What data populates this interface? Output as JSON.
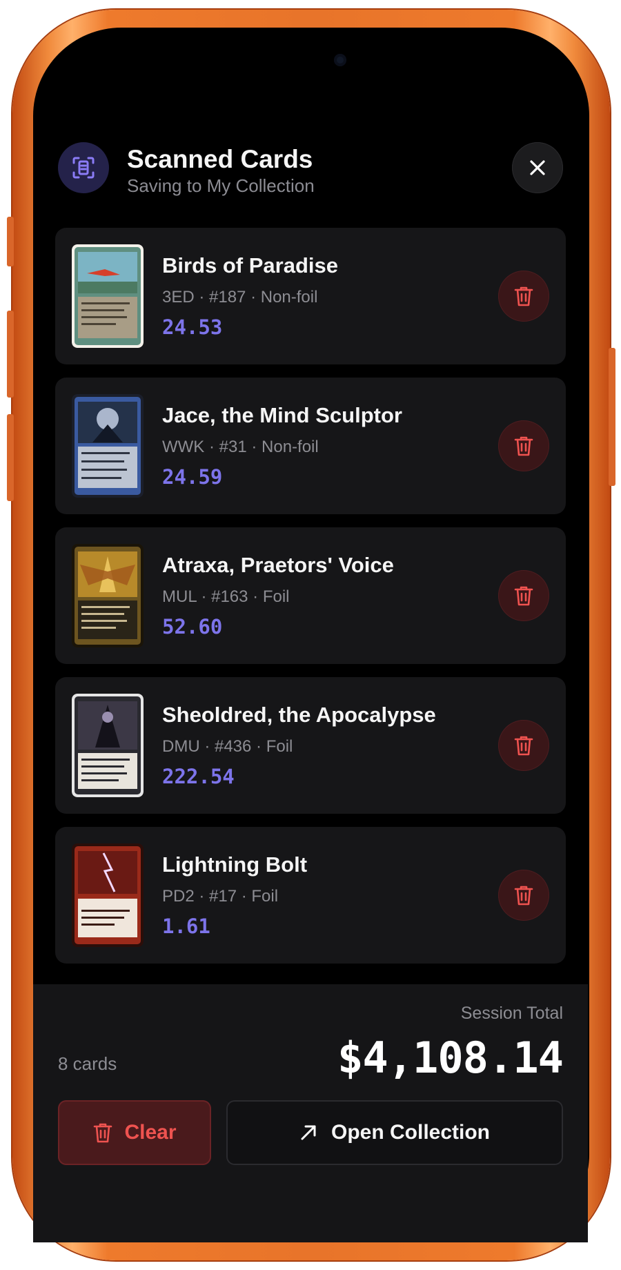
{
  "header": {
    "title": "Scanned Cards",
    "subtitle": "Saving to My Collection",
    "icon": "scan-card-icon",
    "close_icon": "close-icon"
  },
  "cards": [
    {
      "name": "Birds of Paradise",
      "meta": "3ED · #187 · Non-foil",
      "price": "24.53",
      "art": "birds-of-paradise-card-image"
    },
    {
      "name": "Jace, the Mind Sculptor",
      "meta": "WWK · #31 · Non-foil",
      "price": "24.59",
      "art": "jace-card-image"
    },
    {
      "name": "Atraxa, Praetors' Voice",
      "meta": "MUL · #163 · Foil",
      "price": "52.60",
      "art": "atraxa-card-image"
    },
    {
      "name": "Sheoldred, the Apocalypse",
      "meta": "DMU · #436 · Foil",
      "price": "222.54",
      "art": "sheoldred-card-image"
    },
    {
      "name": "Lightning Bolt",
      "meta": "PD2 · #17 · Foil",
      "price": "1.61",
      "art": "lightning-bolt-card-image"
    }
  ],
  "footer": {
    "session_label": "Session Total",
    "total": "$4,108.14",
    "count": "8 cards",
    "clear_label": "Clear",
    "open_label": "Open Collection"
  },
  "colors": {
    "accent_price": "#7d74ea",
    "danger": "#ef5350",
    "frame": "#e8742a",
    "background": "#000000"
  }
}
